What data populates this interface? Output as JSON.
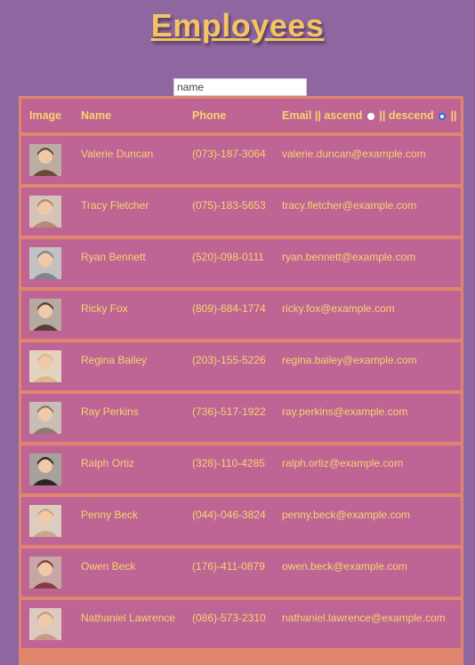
{
  "page": {
    "title": "Employees"
  },
  "search": {
    "placeholder": "name"
  },
  "table": {
    "headers": {
      "image": "Image",
      "name": "Name",
      "phone": "Phone",
      "email": "Email",
      "sep1": "||",
      "ascend": "ascend",
      "sep2": "||",
      "descend": "descend",
      "sep3": "||"
    },
    "sort": {
      "ascend_checked": false,
      "descend_checked": true
    },
    "rows": [
      {
        "name": "Valerie Duncan",
        "phone": "(073)-187-3064",
        "email": "valerie.duncan@example.com",
        "avatar_color": "#6b4a3a"
      },
      {
        "name": "Tracy Fletcher",
        "phone": "(075)-183-5653",
        "email": "tracy.fletcher@example.com",
        "avatar_color": "#b58a72"
      },
      {
        "name": "Ryan Bennett",
        "phone": "(520)-098-0111",
        "email": "ryan.bennett@example.com",
        "avatar_color": "#7d8590"
      },
      {
        "name": "Ricky Fox",
        "phone": "(809)-684-1774",
        "email": "ricky.fox@example.com",
        "avatar_color": "#5a4030"
      },
      {
        "name": "Regina Bailey",
        "phone": "(203)-155-5226",
        "email": "regina.bailey@example.com",
        "avatar_color": "#d9b98a"
      },
      {
        "name": "Ray Perkins",
        "phone": "(736)-517-1922",
        "email": "ray.perkins@example.com",
        "avatar_color": "#8d7a6e"
      },
      {
        "name": "Ralph Ortiz",
        "phone": "(328)-110-4285",
        "email": "ralph.ortiz@example.com",
        "avatar_color": "#2e2522"
      },
      {
        "name": "Penny Beck",
        "phone": "(044)-046-3824",
        "email": "penny.beck@example.com",
        "avatar_color": "#c9a78c"
      },
      {
        "name": "Owen Beck",
        "phone": "(176)-411-0879",
        "email": "owen.beck@example.com",
        "avatar_color": "#8a3a3f"
      },
      {
        "name": "Nathaniel Lawrence",
        "phone": "(086)-573-2310",
        "email": "nathaniel.lawrence@example.com",
        "avatar_color": "#c89a86"
      }
    ]
  }
}
